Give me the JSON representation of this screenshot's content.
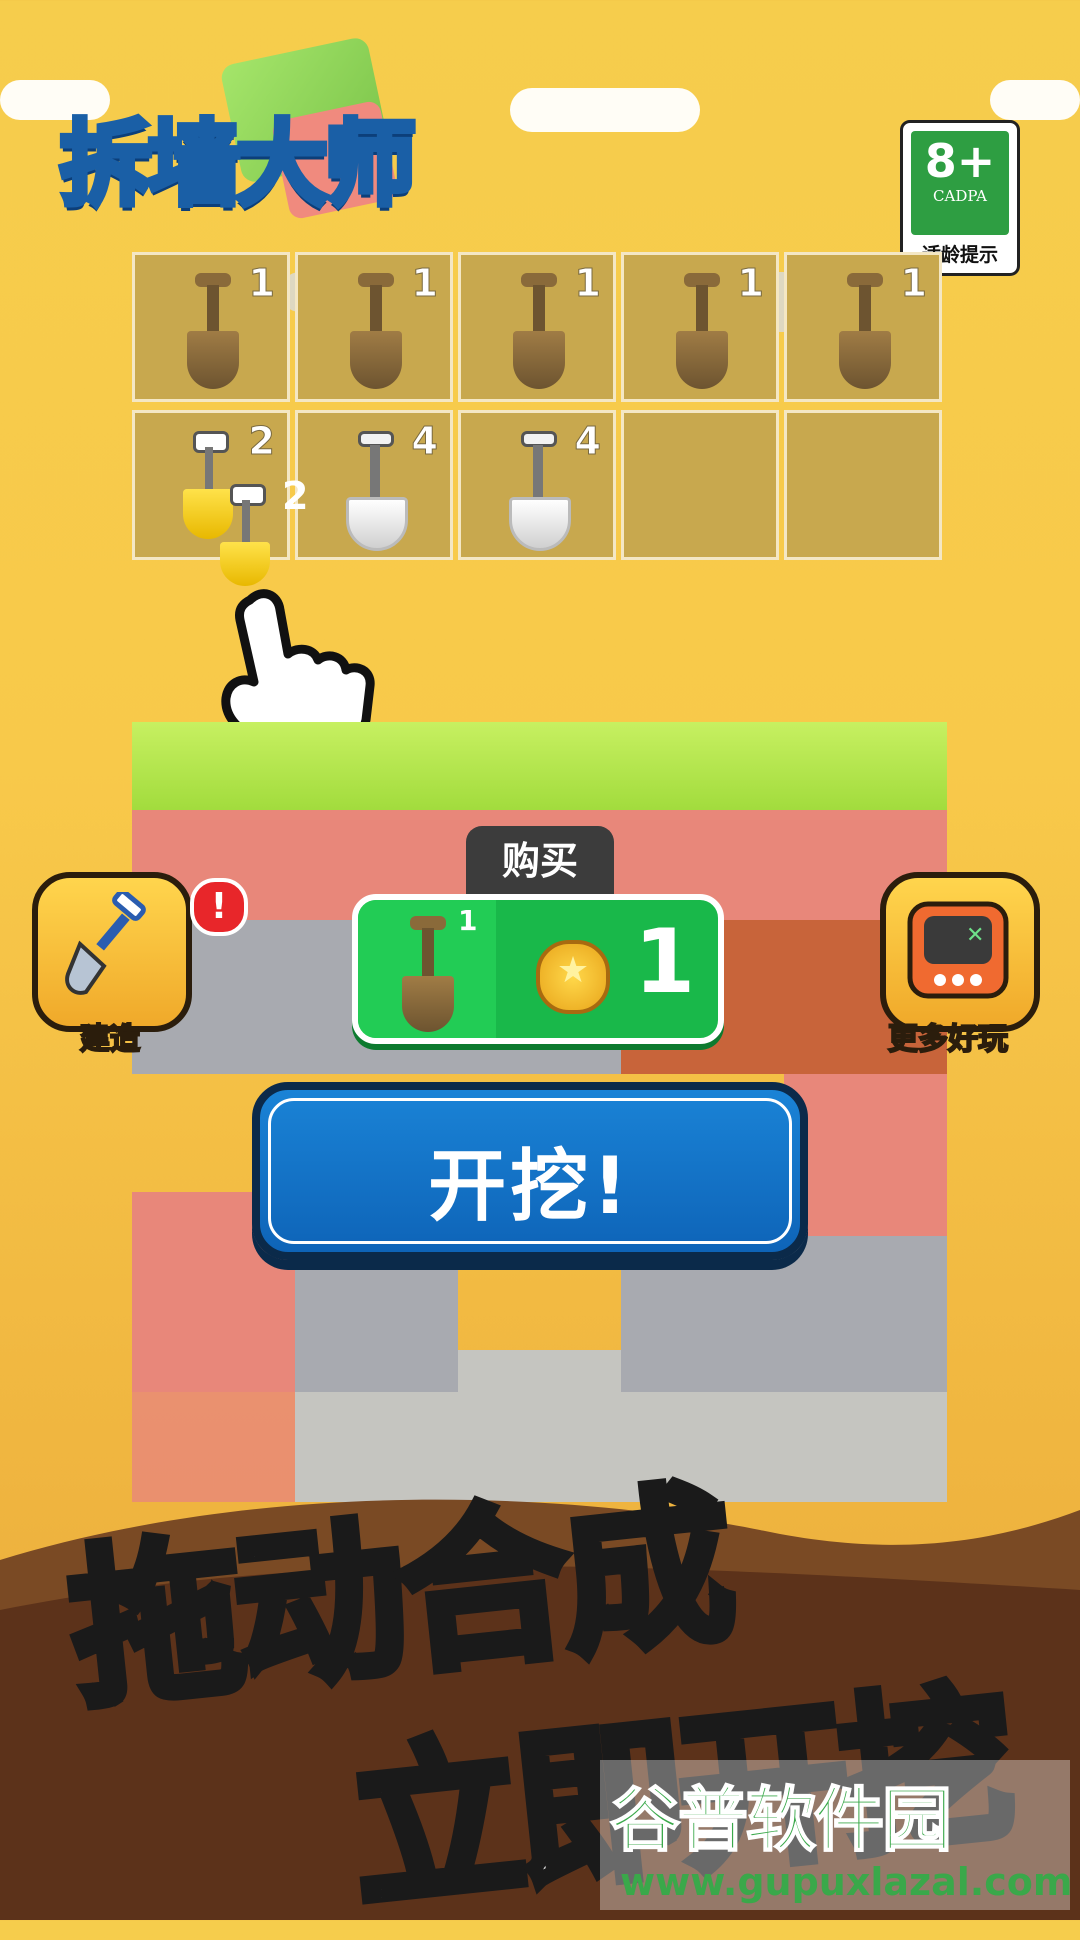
{
  "logo": {
    "title": "拆墙大师"
  },
  "age_badge": {
    "rating": "8+",
    "org": "CADPA",
    "tip": "适龄提示"
  },
  "merge_grid": {
    "row1": [
      {
        "item": "brown-shovel",
        "count": "1"
      },
      {
        "item": "brown-shovel",
        "count": "1"
      },
      {
        "item": "brown-shovel",
        "count": "1"
      },
      {
        "item": "brown-shovel",
        "count": "1"
      },
      {
        "item": "brown-shovel",
        "count": "1"
      }
    ],
    "row2": [
      {
        "item": "gold-shovel",
        "count": "2"
      },
      {
        "item": "white-shovel",
        "count": "4"
      },
      {
        "item": "white-shovel",
        "count": "4"
      },
      {
        "item": "empty",
        "count": ""
      },
      {
        "item": "empty",
        "count": ""
      }
    ],
    "dragging": {
      "item": "gold-shovel",
      "count": "2"
    }
  },
  "side_left": {
    "label": "建造",
    "badge": "!"
  },
  "side_right": {
    "label": "更多好玩"
  },
  "buy": {
    "tag": "购买",
    "item_count": "1",
    "price": "1"
  },
  "dig_button": {
    "label": "开挖!"
  },
  "slogans": {
    "line1": "拖动合成",
    "line2": "立即开挖"
  },
  "watermark": {
    "name": "谷普软件园",
    "url": "www.gupuxlazal.com"
  },
  "colors": {
    "sky": "#f6cd4c",
    "grid_cell": "#c8a84e",
    "buy_green": "#19b84a",
    "dig_blue": "#1a83d6",
    "ground": "#6a3a1c"
  }
}
